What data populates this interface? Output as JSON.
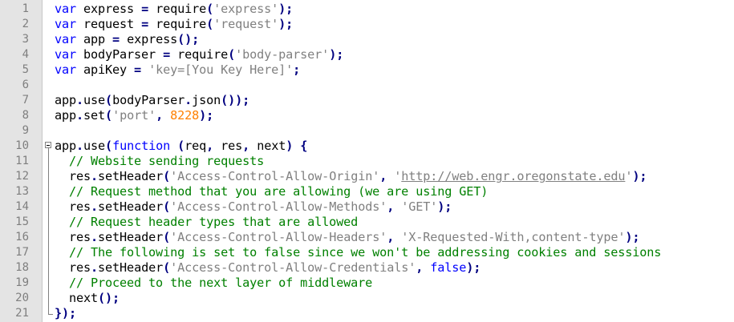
{
  "editor": {
    "lines": [
      {
        "num": "1",
        "segs": [
          {
            "t": "var",
            "c": "kw"
          },
          {
            "t": " express ",
            "c": ""
          },
          {
            "t": "=",
            "c": "op"
          },
          {
            "t": " require",
            "c": ""
          },
          {
            "t": "(",
            "c": "op"
          },
          {
            "t": "'express'",
            "c": "str"
          },
          {
            "t": ");",
            "c": "op"
          }
        ]
      },
      {
        "num": "2",
        "segs": [
          {
            "t": "var",
            "c": "kw"
          },
          {
            "t": " request ",
            "c": ""
          },
          {
            "t": "=",
            "c": "op"
          },
          {
            "t": " require",
            "c": ""
          },
          {
            "t": "(",
            "c": "op"
          },
          {
            "t": "'request'",
            "c": "str"
          },
          {
            "t": ");",
            "c": "op"
          }
        ]
      },
      {
        "num": "3",
        "segs": [
          {
            "t": "var",
            "c": "kw"
          },
          {
            "t": " app ",
            "c": ""
          },
          {
            "t": "=",
            "c": "op"
          },
          {
            "t": " express",
            "c": ""
          },
          {
            "t": "();",
            "c": "op"
          }
        ]
      },
      {
        "num": "4",
        "segs": [
          {
            "t": "var",
            "c": "kw"
          },
          {
            "t": " bodyParser ",
            "c": ""
          },
          {
            "t": "=",
            "c": "op"
          },
          {
            "t": " require",
            "c": ""
          },
          {
            "t": "(",
            "c": "op"
          },
          {
            "t": "'body-parser'",
            "c": "str"
          },
          {
            "t": ");",
            "c": "op"
          }
        ]
      },
      {
        "num": "5",
        "segs": [
          {
            "t": "var",
            "c": "kw"
          },
          {
            "t": " apiKey ",
            "c": ""
          },
          {
            "t": "=",
            "c": "op"
          },
          {
            "t": " ",
            "c": ""
          },
          {
            "t": "'key=[You Key Here]'",
            "c": "str"
          },
          {
            "t": ";",
            "c": "op"
          }
        ]
      },
      {
        "num": "6",
        "segs": []
      },
      {
        "num": "7",
        "segs": [
          {
            "t": "app",
            "c": ""
          },
          {
            "t": ".",
            "c": "op"
          },
          {
            "t": "use",
            "c": ""
          },
          {
            "t": "(",
            "c": "op"
          },
          {
            "t": "bodyParser",
            "c": ""
          },
          {
            "t": ".",
            "c": "op"
          },
          {
            "t": "json",
            "c": ""
          },
          {
            "t": "());",
            "c": "op"
          }
        ]
      },
      {
        "num": "8",
        "segs": [
          {
            "t": "app",
            "c": ""
          },
          {
            "t": ".",
            "c": "op"
          },
          {
            "t": "set",
            "c": ""
          },
          {
            "t": "(",
            "c": "op"
          },
          {
            "t": "'port'",
            "c": "str"
          },
          {
            "t": ",",
            "c": "op"
          },
          {
            "t": " ",
            "c": ""
          },
          {
            "t": "8228",
            "c": "num"
          },
          {
            "t": ");",
            "c": "op"
          }
        ]
      },
      {
        "num": "9",
        "segs": []
      },
      {
        "num": "10",
        "segs": [
          {
            "t": "app",
            "c": ""
          },
          {
            "t": ".",
            "c": "op"
          },
          {
            "t": "use",
            "c": ""
          },
          {
            "t": "(",
            "c": "op"
          },
          {
            "t": "function",
            "c": "kw"
          },
          {
            "t": " ",
            "c": ""
          },
          {
            "t": "(",
            "c": "op"
          },
          {
            "t": "req",
            "c": ""
          },
          {
            "t": ",",
            "c": "op"
          },
          {
            "t": " res",
            "c": ""
          },
          {
            "t": ",",
            "c": "op"
          },
          {
            "t": " next",
            "c": ""
          },
          {
            "t": ")",
            "c": "op"
          },
          {
            "t": " ",
            "c": ""
          },
          {
            "t": "{",
            "c": "op"
          }
        ]
      },
      {
        "num": "11",
        "segs": [
          {
            "t": "  ",
            "c": ""
          },
          {
            "t": "// Website sending requests",
            "c": "cmt"
          }
        ]
      },
      {
        "num": "12",
        "segs": [
          {
            "t": "  res",
            "c": ""
          },
          {
            "t": ".",
            "c": "op"
          },
          {
            "t": "setHeader",
            "c": ""
          },
          {
            "t": "(",
            "c": "op"
          },
          {
            "t": "'Access-Control-Allow-Origin'",
            "c": "str"
          },
          {
            "t": ",",
            "c": "op"
          },
          {
            "t": " ",
            "c": ""
          },
          {
            "t": "'",
            "c": "str"
          },
          {
            "t": "http://web.engr.oregonstate.edu",
            "c": "str url"
          },
          {
            "t": "'",
            "c": "str"
          },
          {
            "t": ");",
            "c": "op"
          }
        ]
      },
      {
        "num": "13",
        "segs": [
          {
            "t": "  ",
            "c": ""
          },
          {
            "t": "// Request method that you are allowing (we are using GET)",
            "c": "cmt"
          }
        ]
      },
      {
        "num": "14",
        "segs": [
          {
            "t": "  res",
            "c": ""
          },
          {
            "t": ".",
            "c": "op"
          },
          {
            "t": "setHeader",
            "c": ""
          },
          {
            "t": "(",
            "c": "op"
          },
          {
            "t": "'Access-Control-Allow-Methods'",
            "c": "str"
          },
          {
            "t": ",",
            "c": "op"
          },
          {
            "t": " ",
            "c": ""
          },
          {
            "t": "'GET'",
            "c": "str"
          },
          {
            "t": ");",
            "c": "op"
          }
        ]
      },
      {
        "num": "15",
        "segs": [
          {
            "t": "  ",
            "c": ""
          },
          {
            "t": "// Request header types that are allowed",
            "c": "cmt"
          }
        ]
      },
      {
        "num": "16",
        "segs": [
          {
            "t": "  res",
            "c": ""
          },
          {
            "t": ".",
            "c": "op"
          },
          {
            "t": "setHeader",
            "c": ""
          },
          {
            "t": "(",
            "c": "op"
          },
          {
            "t": "'Access-Control-Allow-Headers'",
            "c": "str"
          },
          {
            "t": ",",
            "c": "op"
          },
          {
            "t": " ",
            "c": ""
          },
          {
            "t": "'X-Requested-With,content-type'",
            "c": "str"
          },
          {
            "t": ");",
            "c": "op"
          }
        ]
      },
      {
        "num": "17",
        "segs": [
          {
            "t": "  ",
            "c": ""
          },
          {
            "t": "// The following is set to false since we won't be addressing cookies and sessions",
            "c": "cmt"
          }
        ]
      },
      {
        "num": "18",
        "segs": [
          {
            "t": "  res",
            "c": ""
          },
          {
            "t": ".",
            "c": "op"
          },
          {
            "t": "setHeader",
            "c": ""
          },
          {
            "t": "(",
            "c": "op"
          },
          {
            "t": "'Access-Control-Allow-Credentials'",
            "c": "str"
          },
          {
            "t": ",",
            "c": "op"
          },
          {
            "t": " ",
            "c": ""
          },
          {
            "t": "false",
            "c": "kw"
          },
          {
            "t": ");",
            "c": "op"
          }
        ]
      },
      {
        "num": "19",
        "segs": [
          {
            "t": "  ",
            "c": ""
          },
          {
            "t": "// Proceed to the next layer of middleware",
            "c": "cmt"
          }
        ]
      },
      {
        "num": "20",
        "segs": [
          {
            "t": "  next",
            "c": ""
          },
          {
            "t": "();",
            "c": "op"
          }
        ]
      },
      {
        "num": "21",
        "segs": [
          {
            "t": "});",
            "c": "op"
          }
        ]
      }
    ]
  },
  "colors": {
    "keyword": "#0000ff",
    "string": "#808080",
    "number": "#ff8000",
    "comment": "#008000",
    "operator": "#000080",
    "gutter": "#e4e4e4",
    "line_number": "#7f7f7f"
  }
}
